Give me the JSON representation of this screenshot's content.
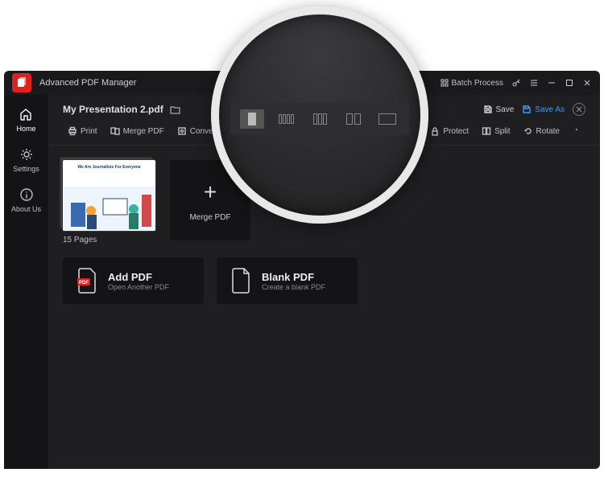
{
  "app": {
    "title": "Advanced PDF Manager",
    "batch": "Batch Process"
  },
  "sidebar": {
    "items": [
      {
        "label": "Home"
      },
      {
        "label": "Settings"
      },
      {
        "label": "About Us"
      }
    ]
  },
  "document": {
    "name": "My Presentation 2.pdf",
    "pages_label": "15 Pages",
    "thumb_headline": "We Are Journalists For Everyone"
  },
  "actions": {
    "save": "Save",
    "save_as": "Save As"
  },
  "toolbar": {
    "print": "Print",
    "merge": "Merge PDF",
    "convert": "Convert",
    "protect": "Protect",
    "split": "Split",
    "rotate": "Rotate"
  },
  "tiles": {
    "merge": "Merge PDF",
    "add_pdf_title": "Add PDF",
    "add_pdf_sub": "Open Another PDF",
    "blank_pdf_title": "Blank PDF",
    "blank_pdf_sub": "Create a blank PDF"
  }
}
